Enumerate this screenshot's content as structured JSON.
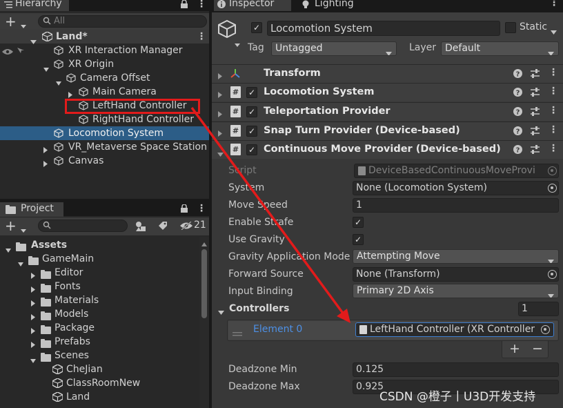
{
  "hierarchy": {
    "tab_label": "Hierarchy",
    "search_placeholder": "All",
    "scene_name": "Land*",
    "items": [
      {
        "label": "XR Interaction Manager"
      },
      {
        "label": "XR Origin"
      },
      {
        "label": "Camera Offset"
      },
      {
        "label": "Main Camera"
      },
      {
        "label": "LeftHand Controller"
      },
      {
        "label": "RightHand Controller"
      },
      {
        "label": "Locomotion System"
      },
      {
        "label": "VR_Metaverse Space Station"
      },
      {
        "label": "Canvas"
      }
    ]
  },
  "project": {
    "tab_label": "Project",
    "hidden_count": "21",
    "tree": [
      {
        "label": "Assets"
      },
      {
        "label": "GameMain"
      },
      {
        "label": "Editor"
      },
      {
        "label": "Fonts"
      },
      {
        "label": "Materials"
      },
      {
        "label": "Models"
      },
      {
        "label": "Package"
      },
      {
        "label": "Prefabs"
      },
      {
        "label": "Scenes"
      },
      {
        "label": "CheJian"
      },
      {
        "label": "ClassRoomNew"
      },
      {
        "label": "Land"
      }
    ]
  },
  "inspector": {
    "tabs": [
      {
        "label": "Inspector"
      },
      {
        "label": "Lighting"
      }
    ],
    "object_name": "Locomotion System",
    "static_label": "Static",
    "tag_label": "Tag",
    "tag_value": "Untagged",
    "layer_label": "Layer",
    "layer_value": "Default",
    "components": [
      {
        "title": "Transform"
      },
      {
        "title": "Locomotion System"
      },
      {
        "title": "Teleportation Provider"
      },
      {
        "title": "Snap Turn Provider (Device-based)"
      },
      {
        "title": "Continuous Move Provider (Device-based)"
      }
    ],
    "properties": {
      "script_label": "Script",
      "script_value": "DeviceBasedContinuousMoveProvi",
      "system_label": "System",
      "system_value": "None (Locomotion System)",
      "move_speed_label": "Move Speed",
      "move_speed_value": "1",
      "enable_strafe_label": "Enable Strafe",
      "use_gravity_label": "Use Gravity",
      "gravity_mode_label": "Gravity Application Mode",
      "gravity_mode_value": "Attempting Move",
      "forward_source_label": "Forward Source",
      "forward_source_value": "None (Transform)",
      "input_binding_label": "Input Binding",
      "input_binding_value": "Primary 2D Axis",
      "controllers_label": "Controllers",
      "controllers_count": "1",
      "element0_label": "Element 0",
      "element0_value": "LeftHand Controller (XR Controller",
      "deadzone_min_label": "Deadzone Min",
      "deadzone_min_value": "0.125",
      "deadzone_max_label": "Deadzone Max",
      "deadzone_max_value": "0.925"
    }
  },
  "watermark": "CSDN @橙子丨U3D开发支持",
  "colors": {
    "annotation_red": "#e21b1b",
    "selection_blue": "#2c5d87",
    "element_blue": "#4d90e6"
  }
}
